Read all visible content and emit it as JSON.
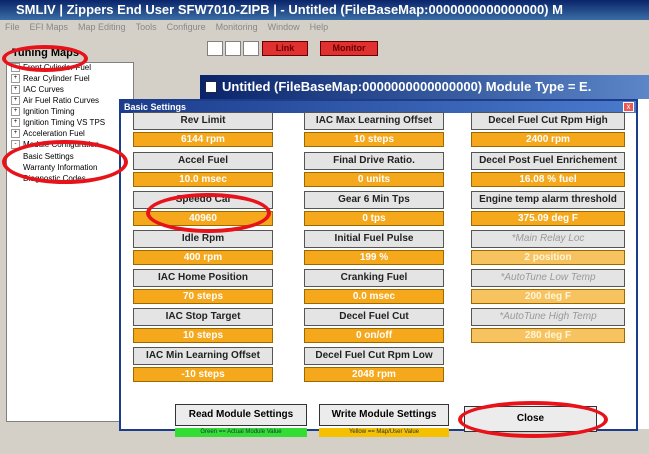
{
  "window": {
    "title": "SMLIV  |  Zippers End User SFW7010-ZIPB  |  - Untitled      (FileBaseMap:0000000000000000) M"
  },
  "menu": [
    "File",
    "EFI Maps",
    "Map Editing",
    "Tools",
    "Configure",
    "Monitoring",
    "Window",
    "Help"
  ],
  "toolbar": {
    "link_label": "Link",
    "monitor_label": "Monitor"
  },
  "tuning_maps": {
    "title": "Tuning Maps",
    "items": [
      {
        "label": "Front Cylinder Fuel",
        "expander": "+"
      },
      {
        "label": "Rear Cylinder Fuel",
        "expander": "+"
      },
      {
        "label": "IAC Curves",
        "expander": "+"
      },
      {
        "label": "Air Fuel Ratio Curves",
        "expander": "+"
      },
      {
        "label": "Ignition Timing",
        "expander": "+"
      },
      {
        "label": "Ignition Timing VS TPS",
        "expander": "+"
      },
      {
        "label": "Acceleration Fuel",
        "expander": "+"
      },
      {
        "label": "Module Configuration",
        "expander": "-"
      },
      {
        "label": "Basic Settings",
        "expander": ""
      },
      {
        "label": "Warranty Information",
        "expander": ""
      },
      {
        "label": "Diagnostic Codes",
        "expander": ""
      }
    ]
  },
  "child_window": {
    "title": "Untitled      (FileBaseMap:0000000000000000) Module Type = E."
  },
  "dialog": {
    "title": "Basic Settings",
    "close_x": "x",
    "col1": [
      {
        "label": "Rev Limit",
        "value": "6144 rpm"
      },
      {
        "label": "Accel Fuel",
        "value": "10.0 msec"
      },
      {
        "label": "Speedo Cal",
        "value": "40960"
      },
      {
        "label": "Idle Rpm",
        "value": "400 rpm"
      },
      {
        "label": "IAC Home Position",
        "value": "70 steps"
      },
      {
        "label": "IAC Stop Target",
        "value": "10 steps"
      },
      {
        "label": "IAC Min Learning Offset",
        "value": "-10 steps"
      }
    ],
    "col2": [
      {
        "label": "IAC Max Learning Offset",
        "value": "10 steps"
      },
      {
        "label": "Final Drive Ratio.",
        "value": "0 units"
      },
      {
        "label": "Gear 6 Min Tps",
        "value": "0 tps"
      },
      {
        "label": "Initial Fuel Pulse",
        "value": "199 %"
      },
      {
        "label": "Cranking Fuel",
        "value": "0.0 msec"
      },
      {
        "label": "Decel Fuel Cut",
        "value": "0 on/off"
      },
      {
        "label": "Decel Fuel Cut Rpm Low",
        "value": "2048 rpm"
      }
    ],
    "col3": [
      {
        "label": "Decel Fuel Cut Rpm High",
        "value": "2400 rpm"
      },
      {
        "label": "Decel Post Fuel Enrichement",
        "value": "16.08 % fuel"
      },
      {
        "label": "Engine temp alarm threshold",
        "value": "375.09 deg F"
      },
      {
        "label": "*Main Relay Loc",
        "value": "2 position"
      },
      {
        "label": "*AutoTune Low Temp",
        "value": "200 deg F"
      },
      {
        "label": "*AutoTune High Temp",
        "value": "280 deg F"
      }
    ],
    "read_button": "Read Module Settings",
    "write_button": "Write Module Settings",
    "close_button": "Close",
    "legend_green": "Green == Actual Module Value",
    "legend_yellow": "Yellow == Map/User Value",
    "colors": {
      "value_bg": "#f5a81c",
      "legend_green": "#33dd33",
      "legend_yellow": "#f5c000",
      "annotation": "#e8121a"
    }
  }
}
